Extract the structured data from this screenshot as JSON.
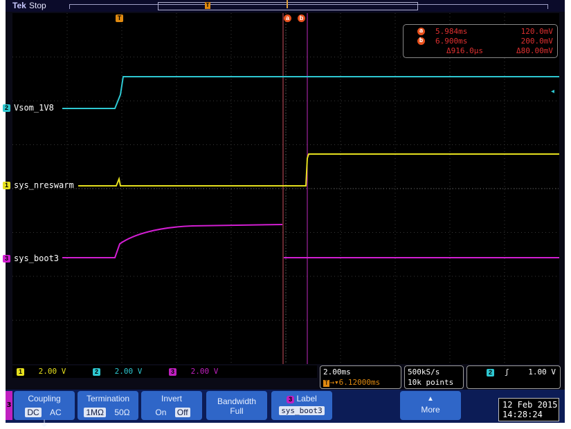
{
  "topbar": {
    "brand": "Tek",
    "run_state": "Stop"
  },
  "markers": {
    "trigger_mark": "T",
    "cursor_a_mark": "a",
    "cursor_b_mark": "b",
    "channel_1": "1",
    "channel_2": "2",
    "channel_3": "3"
  },
  "traces": [
    {
      "channel": "2",
      "label": "Vsom_1V8",
      "color": "#2ec8d2"
    },
    {
      "channel": "1",
      "label": "sys_nreswarm",
      "color": "#e6e01e"
    },
    {
      "channel": "3",
      "label": "sys_boot3",
      "color": "#d21ed2"
    }
  ],
  "cursor_readout": {
    "a_time": "5.984ms",
    "a_value": "120.0mV",
    "b_time": "6.900ms",
    "b_value": "200.0mV",
    "delta_time": "Δ916.0μs",
    "delta_value": "Δ80.00mV"
  },
  "channel_status": [
    {
      "channel": "1",
      "scale": "2.00 V",
      "color": "#e6e01e"
    },
    {
      "channel": "2",
      "scale": "2.00 V",
      "color": "#2ec8d2"
    },
    {
      "channel": "3",
      "scale": "2.00 V",
      "color": "#c020c0"
    }
  ],
  "timebase": {
    "scale": "2.00ms",
    "trigger_position": "6.12000ms"
  },
  "acquisition": {
    "sample_rate": "500kS/s",
    "record_length": "10k points"
  },
  "trigger": {
    "source": "2",
    "slope": "ʃ",
    "level": "1.00 V"
  },
  "menu": {
    "side_channel": "3",
    "coupling": {
      "title": "Coupling",
      "options": [
        "DC",
        "AC",
        "⏚"
      ],
      "selected": "DC"
    },
    "termination": {
      "title": "Termination",
      "options": [
        "1MΩ",
        "50Ω"
      ],
      "selected": "1MΩ"
    },
    "invert": {
      "title": "Invert",
      "options": [
        "On",
        "Off"
      ],
      "selected": "Off"
    },
    "bandwidth": {
      "title": "Bandwidth",
      "value": "Full"
    },
    "label": {
      "title": "Label",
      "value": "sys_boot3",
      "channel": "3"
    },
    "more": {
      "title": "More"
    }
  },
  "datetime": {
    "date": "12 Feb  2015",
    "time": "14:28:24"
  },
  "colors": {
    "ch1": "#e6e01e",
    "ch2": "#2ec8d2",
    "ch3": "#d21ed2",
    "cursor": "#e8501c",
    "trigger": "#e08a10",
    "menu_button": "#2f66c8"
  }
}
